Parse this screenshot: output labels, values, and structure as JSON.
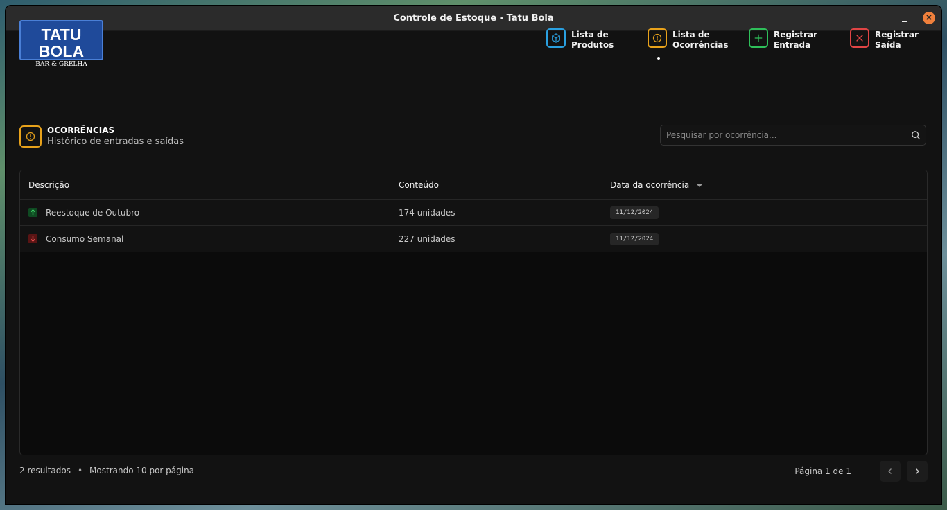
{
  "window": {
    "title": "Controle de Estoque - Tatu Bola"
  },
  "logo": {
    "name": "TATU BOLA",
    "tagline": "— BAR & GRELHA —"
  },
  "nav": {
    "items": [
      {
        "label": "Lista de\nProdutos",
        "icon": "box-icon",
        "color": "#2aa0e0"
      },
      {
        "label": "Lista de\nOcorrências",
        "icon": "alert-icon",
        "color": "#e8a21b",
        "active": true
      },
      {
        "label": "Registrar\nEntrada",
        "icon": "plus-icon",
        "color": "#2fbf5a"
      },
      {
        "label": "Registrar\nSaída",
        "icon": "x-icon",
        "color": "#e04545"
      }
    ]
  },
  "section": {
    "title": "OCORRÊNCIAS",
    "subtitle": "Histórico de entradas e saídas"
  },
  "search": {
    "placeholder": "Pesquisar por ocorrência..."
  },
  "table": {
    "columns": [
      "Descrição",
      "Conteúdo",
      "Data da ocorrência"
    ],
    "rows": [
      {
        "type": "entrada",
        "description": "Reestoque de Outubro",
        "content": "174 unidades",
        "date": "11/12/2024"
      },
      {
        "type": "saida",
        "description": "Consumo Semanal",
        "content": "227 unidades",
        "date": "11/12/2024"
      }
    ]
  },
  "footer": {
    "results": "2 resultados",
    "per_page": "Mostrando 10 por página",
    "page_info": "Página 1 de 1"
  },
  "colors": {
    "accent_orange": "#e8a21b",
    "entrada": "#2fbf5a",
    "saida": "#e04545"
  }
}
